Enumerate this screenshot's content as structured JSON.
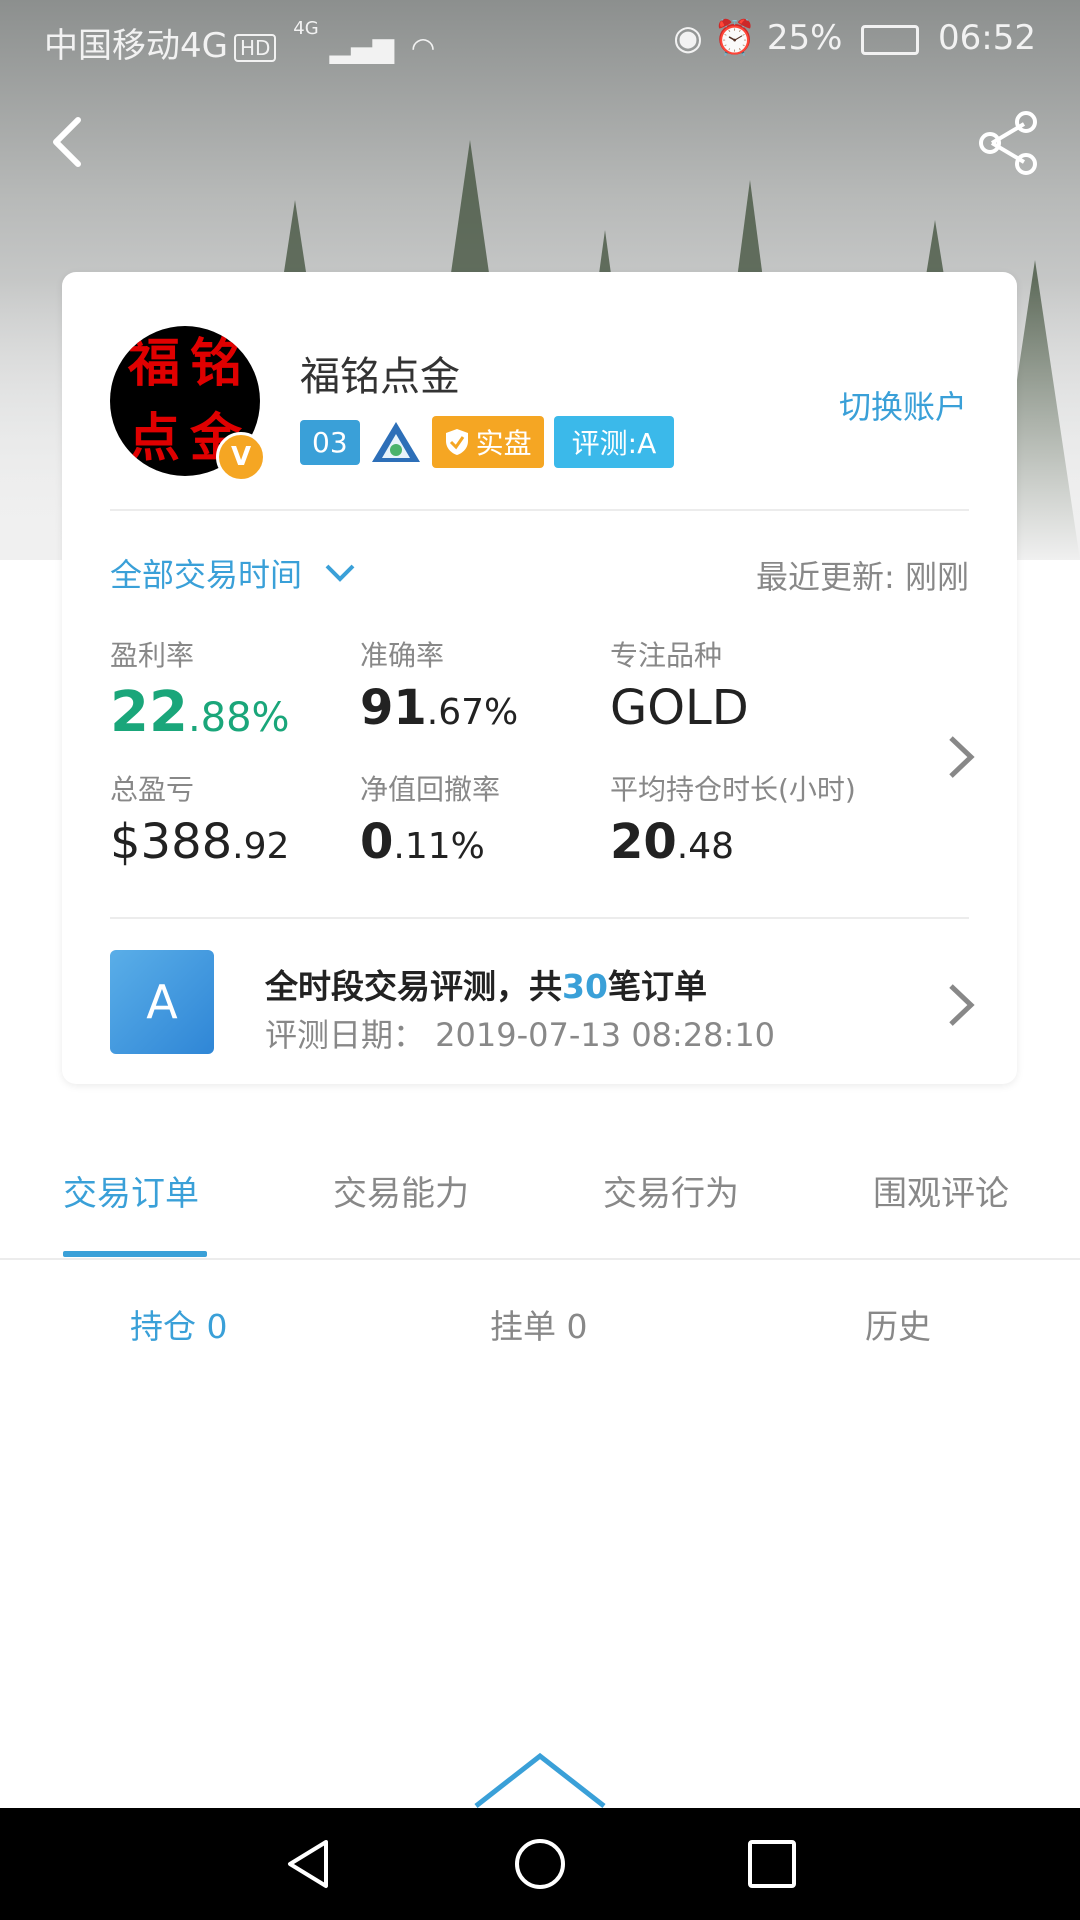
{
  "status_bar": {
    "carrier": "中国移动4G",
    "hd": "HD",
    "network": "4G",
    "battery": "25%",
    "time": "06:52"
  },
  "header": {
    "back_icon": "chevron-left-icon",
    "share_icon": "share-icon"
  },
  "profile": {
    "avatar_text": [
      "福",
      "铭",
      "点",
      "金"
    ],
    "verified_mark": "V",
    "name": "福铭点金",
    "switch_account": "切换账户",
    "badges": {
      "number": "03",
      "real": "实盘",
      "evaluation": "评测:A"
    }
  },
  "filter": {
    "period": "全部交易时间",
    "updated": "最近更新: 刚刚"
  },
  "stats": [
    {
      "label": "盈利率",
      "int": "22",
      "dec": ".88%",
      "color": "#1aa67a"
    },
    {
      "label": "准确率",
      "int": "91",
      "dec": ".67%"
    },
    {
      "label": "专注品种",
      "int": "GOLD",
      "dec": ""
    },
    {
      "label": "总盈亏",
      "int": "$388",
      "dec": ".92"
    },
    {
      "label": "净值回撤率",
      "int": "0",
      "dec": ".11%"
    },
    {
      "label": "平均持仓时长(小时)",
      "int": "20",
      "dec": ".48"
    }
  ],
  "evaluation": {
    "grade": "A",
    "title_prefix": "全时段交易评测，共",
    "count": "30",
    "title_suffix": "笔订单",
    "date": "评测日期： 2019-07-13 08:28:10"
  },
  "tabs": [
    "交易订单",
    "交易能力",
    "交易行为",
    "围观评论"
  ],
  "active_tab": 0,
  "subtabs": [
    "持仓 0",
    "挂单 0",
    "历史"
  ],
  "active_subtab": 0,
  "colors": {
    "accent": "#3aa0d8",
    "profit": "#1aa67a",
    "gold": "#f5a623"
  }
}
